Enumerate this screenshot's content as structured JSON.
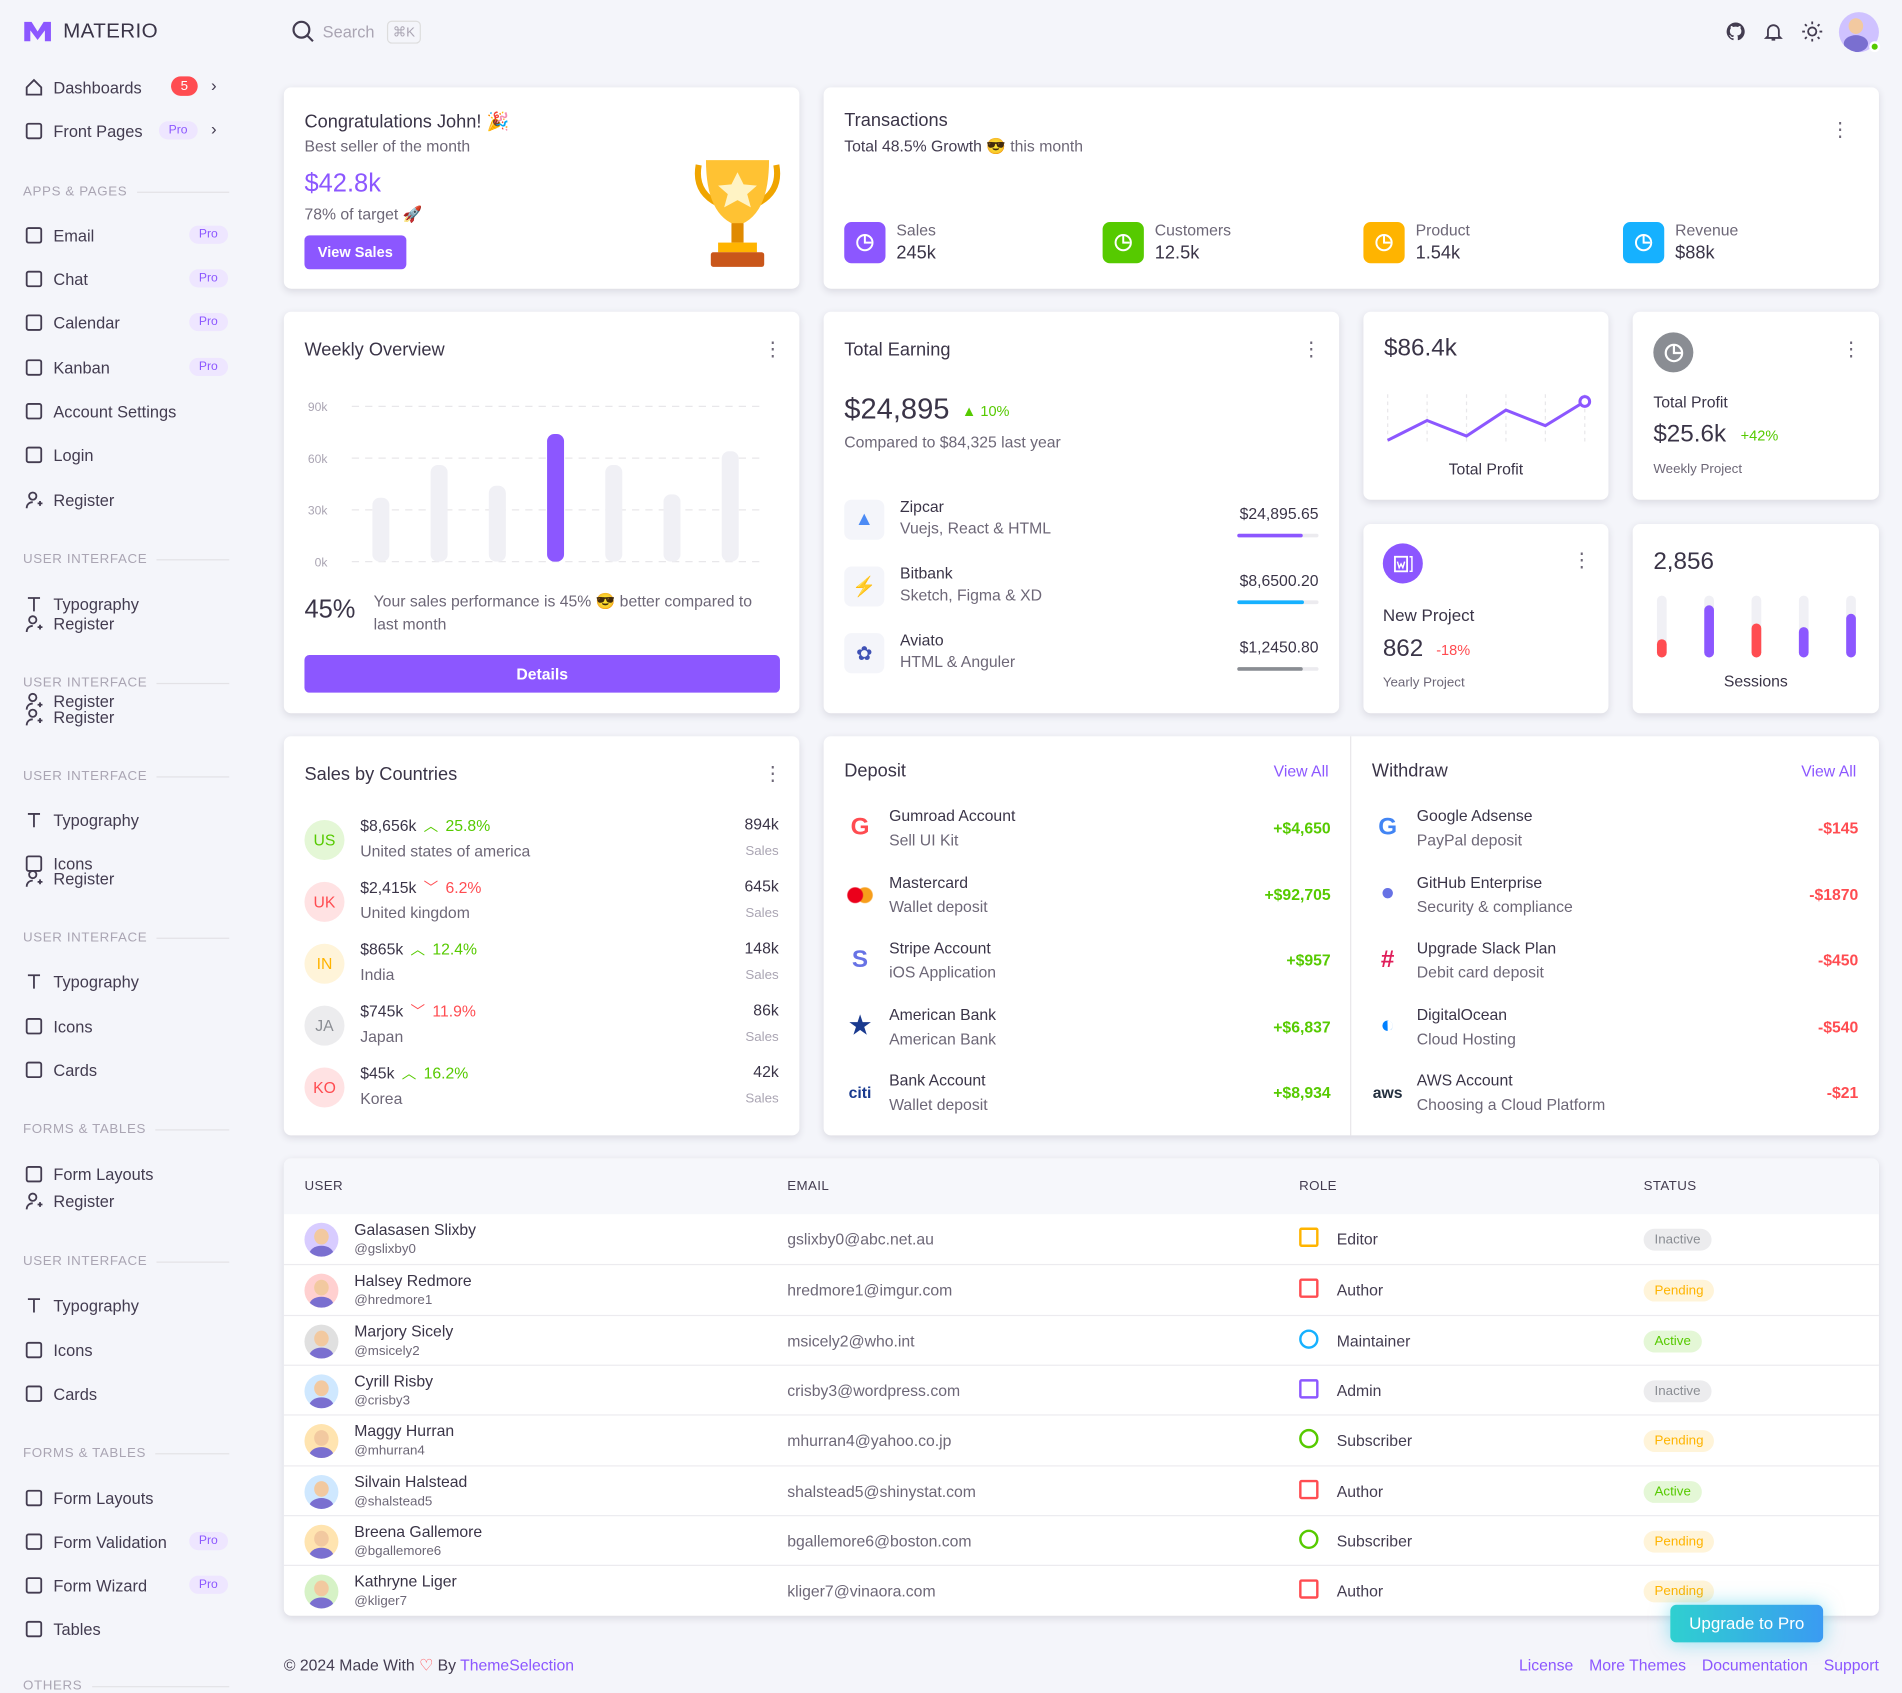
{
  "brand": {
    "name": "MATERIO"
  },
  "topbar": {
    "search_placeholder": "Search",
    "shortcut": "⌘K"
  },
  "sidebar": {
    "items": [
      {
        "type": "item",
        "label": "Dashboards",
        "icon": "home-icon",
        "badge": "5",
        "chevron": true
      },
      {
        "type": "item",
        "label": "Front Pages",
        "icon": "pages-icon",
        "pro": "Pro",
        "chevron": true
      },
      {
        "type": "section",
        "label": "APPS & PAGES"
      },
      {
        "type": "item",
        "label": "Email",
        "icon": "mail-icon",
        "pro": "Pro"
      },
      {
        "type": "item",
        "label": "Chat",
        "icon": "chat-icon",
        "pro": "Pro"
      },
      {
        "type": "item",
        "label": "Calendar",
        "icon": "calendar-icon",
        "pro": "Pro"
      },
      {
        "type": "item",
        "label": "Kanban",
        "icon": "kanban-icon",
        "pro": "Pro"
      },
      {
        "type": "item",
        "label": "Account Settings",
        "icon": "user-settings-icon"
      },
      {
        "type": "item",
        "label": "Login",
        "icon": "login-icon"
      },
      {
        "type": "item",
        "label": "Register",
        "icon": "user-add-icon"
      },
      {
        "type": "section",
        "label": "USER INTERFACE"
      },
      {
        "type": "item",
        "label": "Typography",
        "icon": "typography-icon"
      },
      {
        "type": "item",
        "label": "Register",
        "icon": "user-add-icon"
      },
      {
        "type": "section",
        "label": "USER INTERFACE"
      },
      {
        "type": "item",
        "label": "Register",
        "icon": "user-add-icon"
      },
      {
        "type": "item",
        "label": "Register",
        "icon": "user-add-icon"
      },
      {
        "type": "section",
        "label": "USER INTERFACE"
      },
      {
        "type": "item",
        "label": "Typography",
        "icon": "typography-icon"
      },
      {
        "type": "item",
        "label": "Icons",
        "icon": "icons-icon"
      },
      {
        "type": "item",
        "label": "Register",
        "icon": "user-add-icon"
      },
      {
        "type": "section",
        "label": "USER INTERFACE"
      },
      {
        "type": "item",
        "label": "Typography",
        "icon": "typography-icon"
      },
      {
        "type": "item",
        "label": "Icons",
        "icon": "icons-icon"
      },
      {
        "type": "item",
        "label": "Cards",
        "icon": "cards-icon"
      },
      {
        "type": "section",
        "label": "FORMS & TABLES"
      },
      {
        "type": "item",
        "label": "Form Layouts",
        "icon": "layout-icon"
      },
      {
        "type": "item",
        "label": "Register",
        "icon": "user-add-icon"
      },
      {
        "type": "section",
        "label": "USER INTERFACE"
      },
      {
        "type": "item",
        "label": "Typography",
        "icon": "typography-icon"
      },
      {
        "type": "item",
        "label": "Icons",
        "icon": "icons-icon"
      },
      {
        "type": "item",
        "label": "Cards",
        "icon": "cards-icon"
      },
      {
        "type": "section",
        "label": "FORMS & TABLES"
      },
      {
        "type": "item",
        "label": "Form Layouts",
        "icon": "layout-icon"
      },
      {
        "type": "item",
        "label": "Form Validation",
        "icon": "checkbox-icon",
        "pro": "Pro"
      },
      {
        "type": "item",
        "label": "Form Wizard",
        "icon": "wizard-icon",
        "pro": "Pro"
      },
      {
        "type": "item",
        "label": "Tables",
        "icon": "table-icon"
      },
      {
        "type": "section",
        "label": "OTHERS"
      }
    ]
  },
  "congrats": {
    "title": "Congratulations John! 🎉",
    "subtitle": "Best seller of the month",
    "amount": "$42.8k",
    "target": "78% of target 🚀",
    "button": "View Sales"
  },
  "transactions": {
    "title": "Transactions",
    "growth": "Total 48.5% Growth",
    "growth_suffix": "😎 this month",
    "stats": [
      {
        "label": "Sales",
        "value": "245k",
        "color": "#8c57ff",
        "icon": "pie-chart-icon"
      },
      {
        "label": "Customers",
        "value": "12.5k",
        "color": "#56ca00",
        "icon": "users-icon"
      },
      {
        "label": "Product",
        "value": "1.54k",
        "color": "#ffb400",
        "icon": "laptop-icon"
      },
      {
        "label": "Revenue",
        "value": "$88k",
        "color": "#16b1ff",
        "icon": "dollar-icon"
      }
    ]
  },
  "weekly": {
    "title": "Weekly Overview",
    "percent": "45%",
    "text": "Your sales performance is 45% 😎 better compared to last month",
    "button": "Details"
  },
  "chart_data": {
    "type": "bar",
    "y_ticks": [
      "90k",
      "60k",
      "30k",
      "0k"
    ],
    "ylim": [
      0,
      90000
    ],
    "values": [
      37000,
      56000,
      44000,
      74000,
      56000,
      39000,
      64000
    ],
    "highlight_index": 3,
    "grid": true,
    "colors": {
      "bar": "#f0f0f5",
      "highlight": "#8c57ff"
    }
  },
  "earning": {
    "title": "Total Earning",
    "amount": "$24,895",
    "change": "10%",
    "compare": "Compared to $84,325 last year",
    "items": [
      {
        "name": "Zipcar",
        "desc": "Vuejs, React & HTML",
        "amount": "$24,895.65",
        "progress": 0.8,
        "color": "#8c57ff",
        "icon": "zipcar-logo-icon"
      },
      {
        "name": "Bitbank",
        "desc": "Sketch, Figma & XD",
        "amount": "$8,6500.20",
        "progress": 0.82,
        "color": "#16b1ff",
        "icon": "bitbank-logo-icon"
      },
      {
        "name": "Aviato",
        "desc": "HTML & Anguler",
        "amount": "$1,2450.80",
        "progress": 0.8,
        "color": "#8a8d93",
        "icon": "aviato-logo-icon"
      }
    ]
  },
  "profit_card": {
    "amount": "$86.4k",
    "label": "Total Profit",
    "trend": [
      0,
      23,
      5,
      35,
      17,
      45
    ]
  },
  "total_profit": {
    "title": "Total Profit",
    "amount": "$25.6k",
    "change": "+42%",
    "sub": "Weekly Project"
  },
  "new_project": {
    "title": "New Project",
    "amount": "862",
    "change": "-18%",
    "sub": "Yearly Project"
  },
  "sessions": {
    "value": "2,856",
    "label": "Sessions",
    "bars": [
      {
        "level": 0.3,
        "color": "#ff4c51"
      },
      {
        "level": 0.85,
        "color": "#8c57ff"
      },
      {
        "level": 0.55,
        "color": "#ff4c51"
      },
      {
        "level": 0.5,
        "color": "#8c57ff"
      },
      {
        "level": 0.7,
        "color": "#8c57ff"
      }
    ]
  },
  "countries": {
    "title": "Sales by Countries",
    "rows": [
      {
        "code": "US",
        "amount": "$8,656k",
        "change": "25.8%",
        "up": true,
        "country": "United states of america",
        "sales": "894k",
        "sales_label": "Sales",
        "bg": "#e4f7d6",
        "fg": "#56ca00"
      },
      {
        "code": "UK",
        "amount": "$2,415k",
        "change": "6.2%",
        "up": false,
        "country": "United kingdom",
        "sales": "645k",
        "sales_label": "Sales",
        "bg": "#ffe2e3",
        "fg": "#ff4c51"
      },
      {
        "code": "IN",
        "amount": "$865k",
        "change": "12.4%",
        "up": true,
        "country": "India",
        "sales": "148k",
        "sales_label": "Sales",
        "bg": "#fff4d9",
        "fg": "#ffb400"
      },
      {
        "code": "JA",
        "amount": "$745k",
        "change": "11.9%",
        "up": false,
        "country": "Japan",
        "sales": "86k",
        "sales_label": "Sales",
        "bg": "#ececee",
        "fg": "#8a8d93"
      },
      {
        "code": "KO",
        "amount": "$45k",
        "change": "16.2%",
        "up": true,
        "country": "Korea",
        "sales": "42k",
        "sales_label": "Sales",
        "bg": "#ffe2e3",
        "fg": "#ff4c51"
      }
    ]
  },
  "deposit": {
    "title": "Deposit",
    "view_all": "View All",
    "rows": [
      {
        "name": "Gumroad Account",
        "desc": "Sell UI Kit",
        "amount": "+$4,650",
        "logo": "gumroad-logo-icon",
        "logo_text": "G",
        "logo_color": "#ff4c51"
      },
      {
        "name": "Mastercard",
        "desc": "Wallet deposit",
        "amount": "+$92,705",
        "logo": "mastercard-logo-icon",
        "logo_text": "",
        "logo_color": "#ff5f00"
      },
      {
        "name": "Stripe Account",
        "desc": "iOS Application",
        "amount": "+$957",
        "logo": "stripe-logo-icon",
        "logo_text": "S",
        "logo_color": "#6772e5"
      },
      {
        "name": "American Bank",
        "desc": "American Bank",
        "amount": "+$6,837",
        "logo": "american-bank-logo-icon",
        "logo_text": "★",
        "logo_color": "#1a3a8f"
      },
      {
        "name": "Bank Account",
        "desc": "Wallet deposit",
        "amount": "+$8,934",
        "logo": "citi-logo-icon",
        "logo_text": "citi",
        "logo_color": "#1a3a8f"
      }
    ]
  },
  "withdraw": {
    "title": "Withdraw",
    "view_all": "View All",
    "rows": [
      {
        "name": "Google Adsense",
        "desc": "PayPal deposit",
        "amount": "-$145",
        "logo": "google-logo-icon",
        "logo_text": "G",
        "logo_color": "#4285f4"
      },
      {
        "name": "GitHub Enterprise",
        "desc": "Security & compliance",
        "amount": "-$1870",
        "logo": "github-logo-icon",
        "logo_text": "●",
        "logo_color": "#6772e5"
      },
      {
        "name": "Upgrade Slack Plan",
        "desc": "Debit card deposit",
        "amount": "-$450",
        "logo": "slack-logo-icon",
        "logo_text": "#",
        "logo_color": "#e01e5a"
      },
      {
        "name": "DigitalOcean",
        "desc": "Cloud Hosting",
        "amount": "-$540",
        "logo": "digitalocean-logo-icon",
        "logo_text": "◐",
        "logo_color": "#0080ff"
      },
      {
        "name": "AWS Account",
        "desc": "Choosing a Cloud Platform",
        "amount": "-$21",
        "logo": "aws-logo-icon",
        "logo_text": "aws",
        "logo_color": "#232f3e"
      }
    ]
  },
  "users_table": {
    "headers": [
      "USER",
      "EMAIL",
      "ROLE",
      "STATUS"
    ],
    "rows": [
      {
        "name": "Galasasen Slixby",
        "handle": "@gslixby0",
        "email": "gslixby0@abc.net.au",
        "role": "Editor",
        "role_icon": "edit-icon",
        "role_color": "#ffb400",
        "status": "Inactive"
      },
      {
        "name": "Halsey Redmore",
        "handle": "@hredmore1",
        "email": "hredmore1@imgur.com",
        "role": "Author",
        "role_icon": "monitor-icon",
        "role_color": "#ff4c51",
        "status": "Pending"
      },
      {
        "name": "Marjory Sicely",
        "handle": "@msicely2",
        "email": "msicely2@who.int",
        "role": "Maintainer",
        "role_icon": "pie-chart-icon",
        "role_color": "#16b1ff",
        "status": "Active"
      },
      {
        "name": "Cyrill Risby",
        "handle": "@crisby3",
        "email": "crisby3@wordpress.com",
        "role": "Admin",
        "role_icon": "crown-icon",
        "role_color": "#8c57ff",
        "status": "Inactive"
      },
      {
        "name": "Maggy Hurran",
        "handle": "@mhurran4",
        "email": "mhurran4@yahoo.co.jp",
        "role": "Subscriber",
        "role_icon": "user-icon",
        "role_color": "#56ca00",
        "status": "Pending"
      },
      {
        "name": "Silvain Halstead",
        "handle": "@shalstead5",
        "email": "shalstead5@shinystat.com",
        "role": "Author",
        "role_icon": "monitor-icon",
        "role_color": "#ff4c51",
        "status": "Active"
      },
      {
        "name": "Breena Gallemore",
        "handle": "@bgallemore6",
        "email": "bgallemore6@boston.com",
        "role": "Subscriber",
        "role_icon": "user-icon",
        "role_color": "#56ca00",
        "status": "Pending"
      },
      {
        "name": "Kathryne Liger",
        "handle": "@kliger7",
        "email": "kliger7@vinaora.com",
        "role": "Author",
        "role_icon": "monitor-icon",
        "role_color": "#ff4c51",
        "status": "Pending"
      }
    ]
  },
  "status_colors": {
    "Inactive": [
      "#ececee",
      "#8a8d93"
    ],
    "Pending": [
      "#fff4d9",
      "#ffb400"
    ],
    "Active": [
      "#e4f7d6",
      "#56ca00"
    ]
  },
  "footer": {
    "copyright": "© 2024 Made With",
    "by": "By",
    "company": "ThemeSelection",
    "links": [
      "License",
      "More Themes",
      "Documentation",
      "Support"
    ]
  },
  "upgrade": {
    "label": "Upgrade to Pro"
  }
}
